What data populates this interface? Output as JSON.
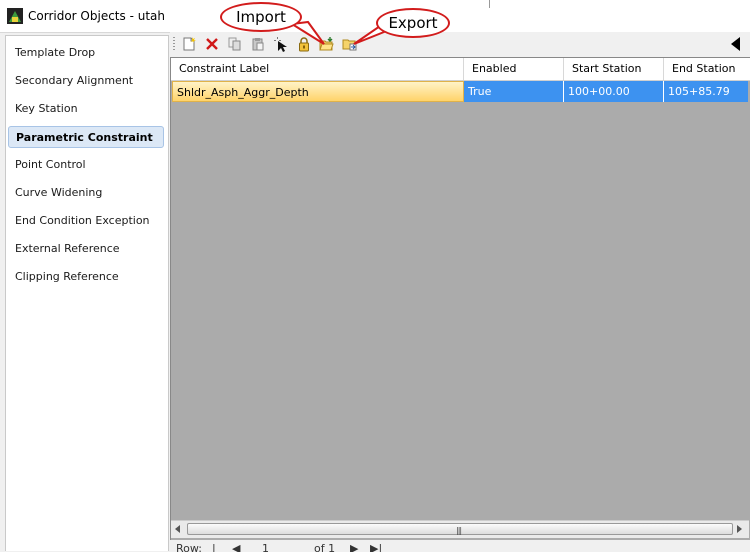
{
  "window": {
    "title": "Corridor Objects - utah"
  },
  "sidebar": {
    "items": [
      {
        "label": "Template Drop"
      },
      {
        "label": "Secondary Alignment"
      },
      {
        "label": "Key Station"
      },
      {
        "label": "Parametric Constraint",
        "selected": true
      },
      {
        "label": "Point Control"
      },
      {
        "label": "Curve Widening"
      },
      {
        "label": "End Condition Exception"
      },
      {
        "label": "External Reference"
      },
      {
        "label": "Clipping Reference"
      }
    ]
  },
  "toolbar": {
    "buttons": [
      "new-icon",
      "delete-icon",
      "copy-icon",
      "paste-icon",
      "select-icon",
      "lock-icon",
      "import-folder-icon",
      "export-folder-icon"
    ]
  },
  "callouts": {
    "import": "Import",
    "export": "Export"
  },
  "grid": {
    "columns": [
      "Constraint Label",
      "Enabled",
      "Start Station",
      "End Station"
    ],
    "rows": [
      {
        "label": "Shldr_Asph_Aggr_Depth",
        "enabled": "True",
        "start": "100+00.00",
        "end": "105+85.79"
      }
    ]
  },
  "pager": {
    "rows_label": "Row:",
    "current": "1",
    "of_label": "of 1"
  },
  "colors": {
    "selection": "#3d92f0",
    "callout_border": "#d21c1c",
    "grid_bg": "#ababab"
  }
}
